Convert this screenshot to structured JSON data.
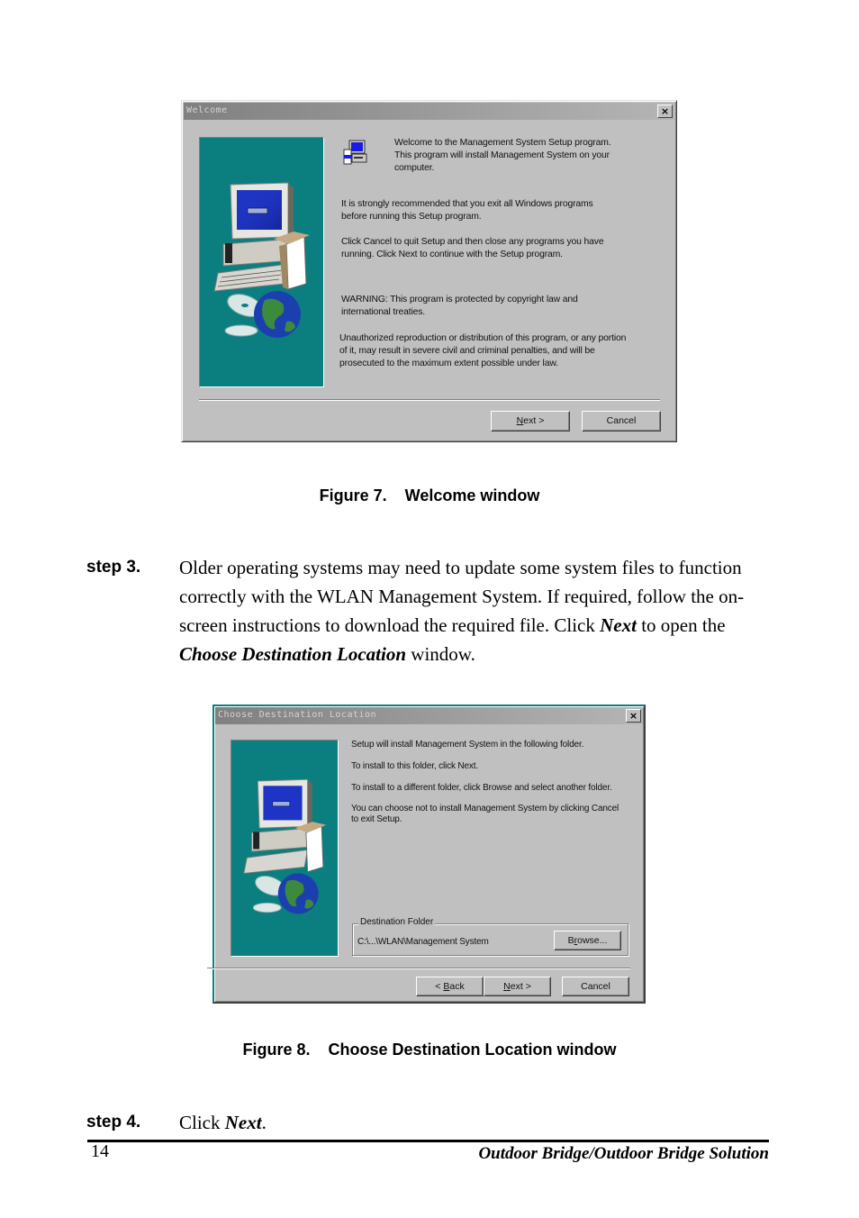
{
  "figure7": {
    "window_title": "Welcome",
    "close_label": "×",
    "paragraphs": [
      "Welcome to the Management System Setup program.\nThis program will install Management System on your\ncomputer.",
      "It is strongly recommended that you exit all Windows programs\nbefore running this Setup program.",
      "Click Cancel to quit Setup and then close any programs you have\nrunning.  Click Next to continue with the Setup program.",
      "WARNING: This program is protected by copyright law and\ninternational treaties.",
      "Unauthorized reproduction or distribution of this program, or any portion\nof it, may result in severe civil and criminal penalties, and will be\nprosecuted to the maximum extent possible under law."
    ],
    "buttons": {
      "next_mnemonic": "N",
      "next_rest": "ext >",
      "cancel": "Cancel"
    },
    "caption": "Figure 7.    Welcome window"
  },
  "step3": {
    "label": "step 3.",
    "text_1": "Older operating systems may need to update some system files to function correctly with the WLAN Management System. If required, follow the on-screen instructions to download the required file. Click ",
    "emph_1": "Next",
    "text_2": " to open the ",
    "emph_2": "Choose Destination Location",
    "text_3": " window."
  },
  "figure8": {
    "window_title": "Choose Destination Location",
    "close_label": "×",
    "paragraphs": [
      "Setup will install Management System in the following folder.",
      "To install to this folder, click Next.",
      "To install to a different folder, click Browse and select another folder.",
      "You can choose not to install Management System by clicking Cancel\nto exit Setup."
    ],
    "destination_group_label": "Destination Folder",
    "destination_path": "C:\\...\\WLAN\\Management System",
    "buttons": {
      "browse_pre": "B",
      "browse_mnemonic": "r",
      "browse_rest": "owse...",
      "back_pre": "< ",
      "back_mnemonic": "B",
      "back_rest": "ack",
      "next_mnemonic": "N",
      "next_rest": "ext >",
      "cancel": "Cancel"
    },
    "caption": "Figure 8.    Choose Destination Location window"
  },
  "step4": {
    "label": "step 4.",
    "text_1": "Click ",
    "emph_1": "Next",
    "text_2": "."
  },
  "footer": {
    "page_number": "14",
    "title": "Outdoor Bridge/Outdoor Bridge Solution"
  }
}
